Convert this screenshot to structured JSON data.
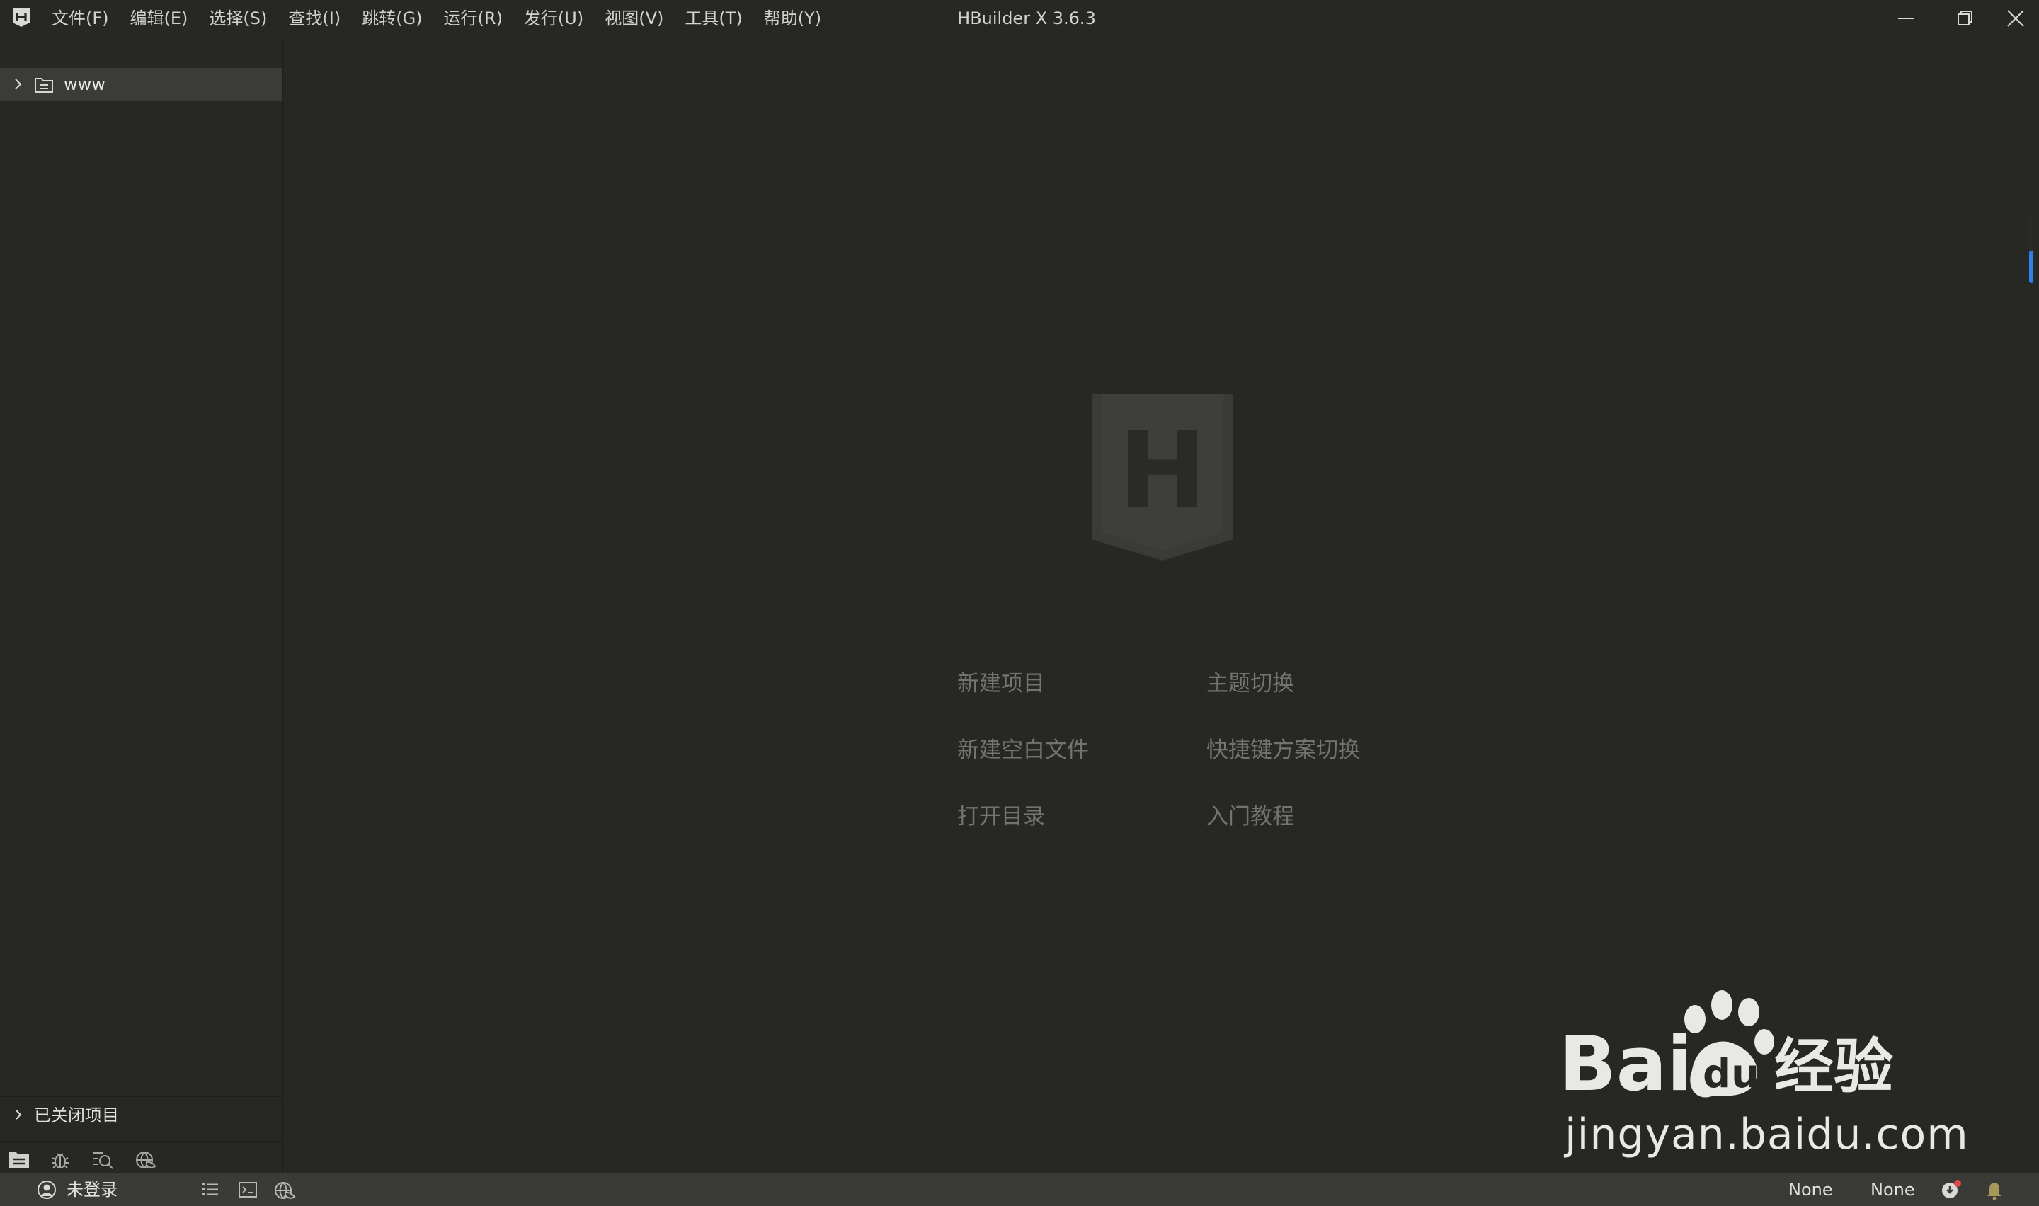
{
  "app": {
    "window_title": "HBuilder X 3.6.3"
  },
  "menu": [
    {
      "label": "文件(F)"
    },
    {
      "label": "编辑(E)"
    },
    {
      "label": "选择(S)"
    },
    {
      "label": "查找(I)"
    },
    {
      "label": "跳转(G)"
    },
    {
      "label": "运行(R)"
    },
    {
      "label": "发行(U)"
    },
    {
      "label": "视图(V)"
    },
    {
      "label": "工具(T)"
    },
    {
      "label": "帮助(Y)"
    }
  ],
  "window_controls": {
    "minimize_icon": "minimize-icon",
    "maximize_icon": "restore-icon",
    "close_icon": "close-icon"
  },
  "sidebar": {
    "project": {
      "label": "www",
      "icon": "folder-icon"
    },
    "closed_projects": {
      "label": "已关闭项目"
    },
    "tabs": [
      {
        "icon": "project-manager-icon"
      },
      {
        "icon": "debug-icon"
      },
      {
        "icon": "search-icon"
      },
      {
        "icon": "browser-icon"
      }
    ]
  },
  "welcome": {
    "logo_letter": "H",
    "links": [
      {
        "label": "新建项目"
      },
      {
        "label": "主题切换"
      },
      {
        "label": "新建空白文件"
      },
      {
        "label": "快捷键方案切换"
      },
      {
        "label": "打开目录"
      },
      {
        "label": "入门教程"
      }
    ]
  },
  "watermark": {
    "brand": "Bai",
    "brand_du": "du",
    "brand_cn": "经验",
    "url": "jingyan.baidu.com"
  },
  "statusbar": {
    "user": "未登录",
    "encoding_left": "None",
    "encoding_right": "None"
  },
  "colors": {
    "background": "#272824",
    "statusbar": "#3a3b36",
    "selected_row": "#3b3c37",
    "accent": "#2f80ed"
  }
}
